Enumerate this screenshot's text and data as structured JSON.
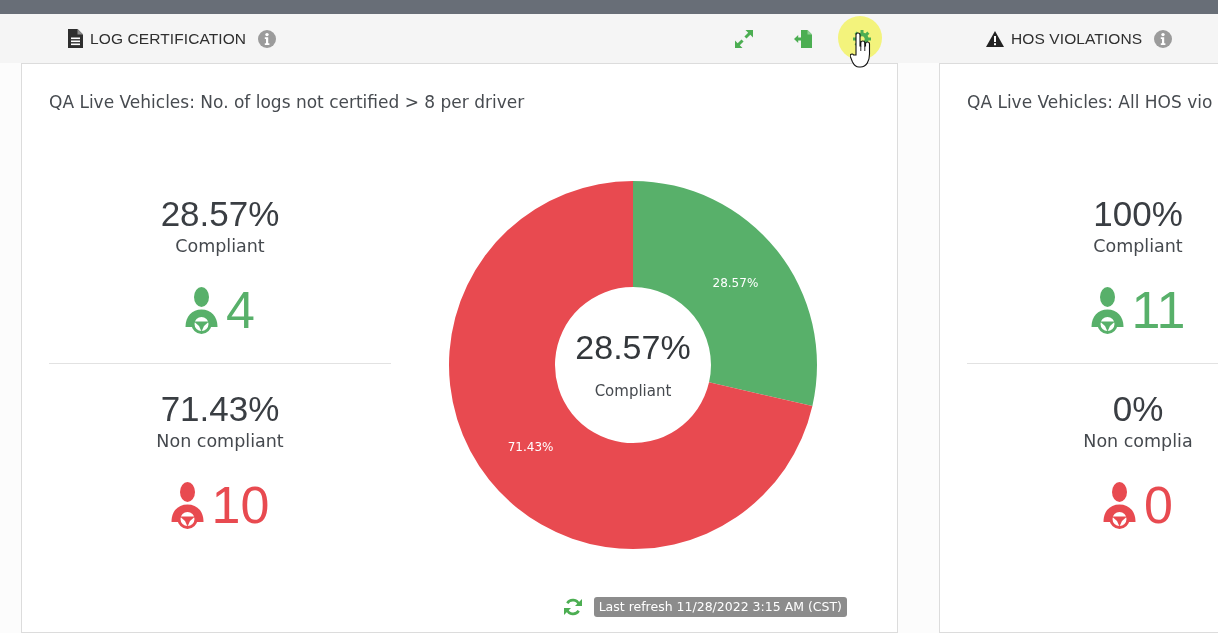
{
  "panels": [
    {
      "kind": "log_certification",
      "title": "LOG CERTIFICATION",
      "toolbar": [
        {
          "kind": "expand",
          "hovered": false
        },
        {
          "kind": "export",
          "hovered": false
        },
        {
          "kind": "settings",
          "hovered": true
        }
      ],
      "card": {
        "title": "QA Live Vehicles: No. of logs not certified > 8 per driver",
        "stats": [
          {
            "percent": "28.57%",
            "label": "Compliant",
            "count": "4",
            "color": "#58b06a"
          },
          {
            "percent": "71.43%",
            "label": "Non compliant",
            "count": "10",
            "color": "#e84a50"
          }
        ],
        "chart_center": {
          "value": "28.57%",
          "label": "Compliant"
        },
        "chart_data": {
          "type": "donut",
          "values": [
            28.57,
            71.43
          ],
          "value_labels": [
            "28.57%",
            "71.43%"
          ]
        },
        "last_refresh": "Last refresh 11/28/2022 3:15 AM (CST)"
      }
    },
    {
      "kind": "hos_violations",
      "title": "HOS VIOLATIONS",
      "card": {
        "title": "QA Live Vehicles: All HOS vio",
        "stats": [
          {
            "percent": "100%",
            "label": "Compliant",
            "count": "11",
            "color": "#58b06a"
          },
          {
            "percent": "0%",
            "label": "Non complia",
            "count": "0",
            "color": "#e84a50"
          }
        ]
      }
    }
  ]
}
